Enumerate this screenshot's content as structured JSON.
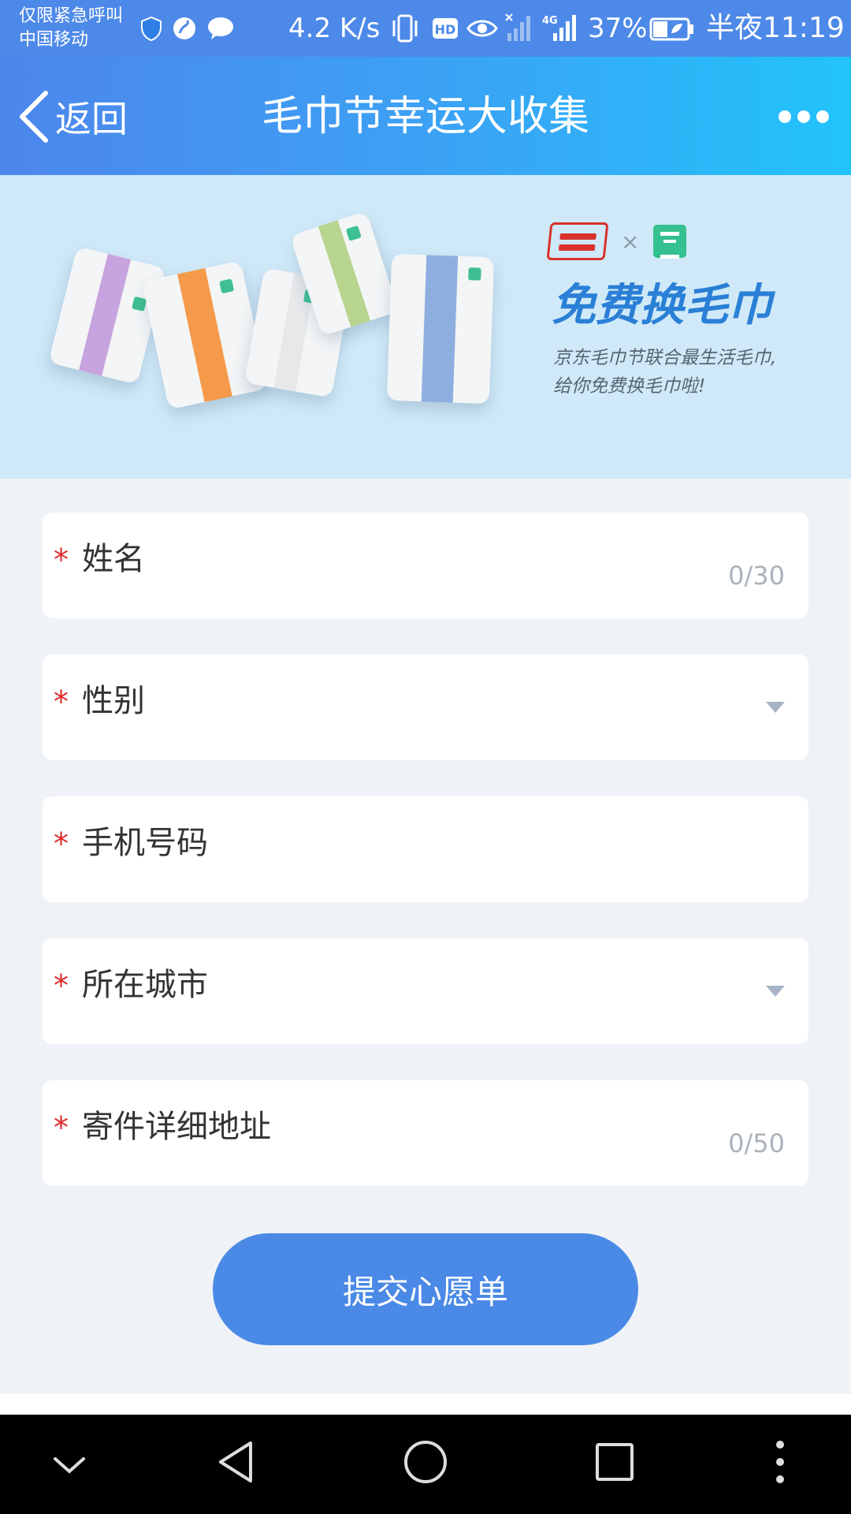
{
  "status_bar": {
    "carrier_line1": "仅限紧急呼叫",
    "carrier_line2": "中国移动",
    "net_speed": "4.2 K/s",
    "battery_percent": "37%",
    "time": "半夜11:19"
  },
  "nav": {
    "back_label": "返回",
    "title": "毛巾节幸运大收集"
  },
  "banner": {
    "headline": "免费换毛巾",
    "desc_line1": "京东毛巾节联合最生活毛巾,",
    "desc_line2": "给你免费换毛巾啦!"
  },
  "form": {
    "required_mark": "*",
    "fields": [
      {
        "label": "姓名",
        "counter": "0/30"
      },
      {
        "label": "性别"
      },
      {
        "label": "手机号码"
      },
      {
        "label": "所在城市"
      },
      {
        "label": "寄件详细地址",
        "counter": "0/50"
      }
    ],
    "submit_label": "提交心愿单"
  },
  "colors": {
    "accent": "#4a89e6",
    "required": "#e0292b",
    "page_background": "#eff3f7"
  }
}
